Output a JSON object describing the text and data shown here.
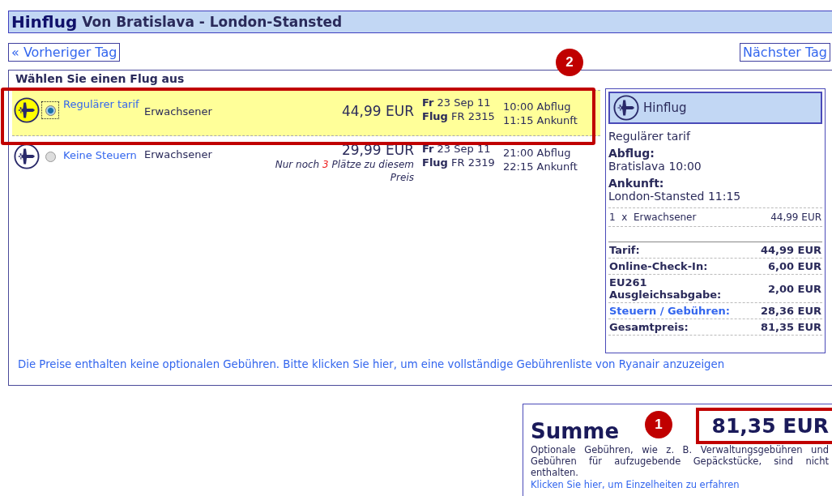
{
  "title": {
    "main": "Hinflug",
    "route": "Von Bratislava - London-Stansted"
  },
  "nav": {
    "previous": "« Vorheriger Tag",
    "next": "Nächster Tag"
  },
  "flights": {
    "heading": "Wählen Sie einen Flug aus",
    "rows": [
      {
        "selected": true,
        "fare": "Regulärer tarif",
        "passenger": "Erwachsener",
        "price": "44,99 EUR",
        "day": "Fr",
        "date": "23 Sep 11",
        "flight_label": "Flug",
        "flight_number": "FR 2315",
        "departure": "10:00 Abflug",
        "arrival": "11:15 Ankunft"
      },
      {
        "selected": false,
        "fare": "Keine Steuern",
        "passenger": "Erwachsener",
        "price": "29,99 EUR",
        "note_before": "Nur noch",
        "seats": "3",
        "note_after": "Plätze zu diesem Preis",
        "day": "Fr",
        "date": "23 Sep 11",
        "flight_label": "Flug",
        "flight_number": "FR 2319",
        "departure": "21:00 Abflug",
        "arrival": "22:15 Ankunft"
      }
    ]
  },
  "summary": {
    "title": "Hinflug",
    "fare": "Regulärer tarif",
    "departure_label": "Abflug:",
    "departure": "Bratislava 10:00",
    "arrival_label": "Ankunft:",
    "arrival": "London-Stansted 11:15",
    "passenger_line": {
      "quantity": "1",
      "times": "x",
      "type": "Erwachsener",
      "price": "44,99 EUR"
    },
    "totals": [
      {
        "kind": "plain",
        "label": "Tarif:",
        "value": "44,99 EUR"
      },
      {
        "kind": "plain",
        "label": "Online-Check-In:",
        "value": "6,00 EUR"
      },
      {
        "kind": "plain",
        "label": "EU261 Ausgleichsabgabe:",
        "value": "2,00 EUR"
      },
      {
        "kind": "link",
        "label": "Steuern / Gebühren:",
        "value": "28,36 EUR"
      },
      {
        "kind": "plain",
        "label": "Gesamtpreis:",
        "value": "81,35 EUR"
      }
    ]
  },
  "fees_link": "Die Preise enthalten keine optionalen Gebühren. Bitte klicken Sie hier, um eine vollständige Gebührenliste von Ryanair anzuzeigen",
  "total": {
    "label": "Summe",
    "amount": "81,35 EUR",
    "note": "Optionale Gebühren, wie z. B. Verwaltungsgebühren und Gebühren für aufzugebende Gepäckstücke, sind nicht enthalten.",
    "link": "Klicken Sie hier, um Einzelheiten zu erfahren"
  },
  "callouts": [
    {
      "number": "2"
    },
    {
      "number": "1"
    }
  ]
}
